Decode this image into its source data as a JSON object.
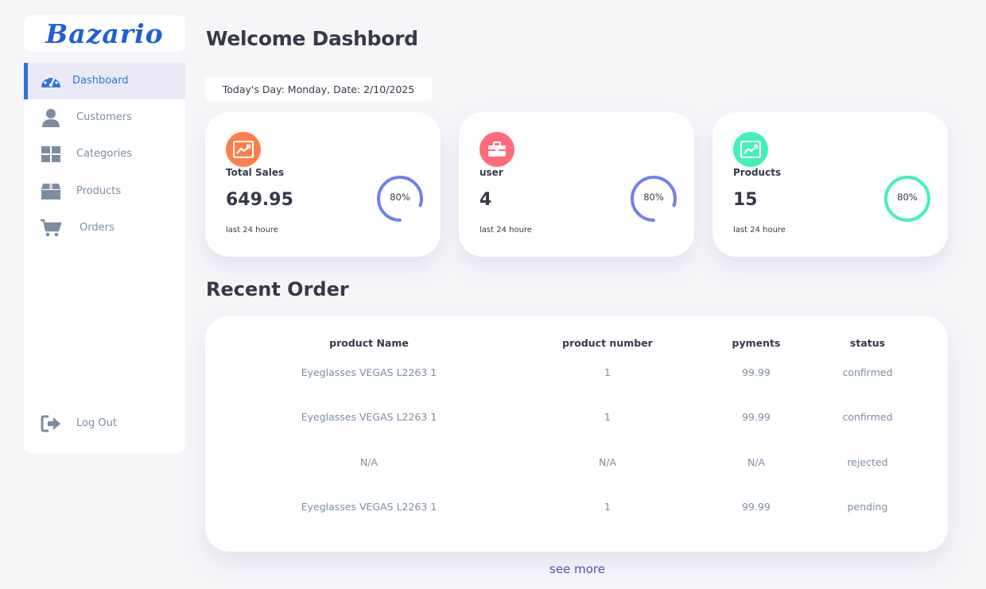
{
  "brand": {
    "logo": "Bazario",
    "color": "#1f5fd6"
  },
  "sidebar": {
    "items": [
      {
        "label": "Dashboard",
        "icon": "dashboard-gauge-icon",
        "active": true
      },
      {
        "label": "Customers",
        "icon": "user-icon",
        "active": false
      },
      {
        "label": "Categories",
        "icon": "grid-icon",
        "active": false
      },
      {
        "label": "Products",
        "icon": "box-icon",
        "active": false
      },
      {
        "label": "Orders",
        "icon": "cart-icon",
        "active": false
      }
    ],
    "logout": {
      "label": "Log Out",
      "icon": "logout-icon"
    }
  },
  "header": {
    "title": "Welcome Dashbord",
    "date_text": "Today's Day: Monday, Date: 2/10/2025"
  },
  "cards": [
    {
      "title": "Total Sales",
      "value": "649.95",
      "sub": "last 24 houre",
      "percent_label": "80%",
      "percent": 80,
      "icon": "chart-line-icon",
      "icon_color": "#ff7d4a",
      "ring_color": "#7380ec"
    },
    {
      "title": "user",
      "value": "4",
      "sub": "last 24 houre",
      "percent_label": "80%",
      "percent": 80,
      "icon": "briefcase-icon",
      "icon_color": "#ff6b7a",
      "ring_color": "#7380ec"
    },
    {
      "title": "Products",
      "value": "15",
      "sub": "last 24 houre",
      "percent_label": "80%",
      "percent": 80,
      "icon": "chart-line-icon",
      "icon_color": "#41f1b6",
      "ring_color": "#41f1b6"
    }
  ],
  "orders": {
    "title": "Recent Order",
    "columns": [
      "product Name",
      "product number",
      "pyments",
      "status"
    ],
    "rows": [
      [
        "Eyeglasses VEGAS L2263 1",
        "1",
        "99.99",
        "confirmed"
      ],
      [
        "Eyeglasses VEGAS L2263 1",
        "1",
        "99.99",
        "confirmed"
      ],
      [
        "N/A",
        "N/A",
        "N/A",
        "rejected"
      ],
      [
        "Eyeglasses VEGAS L2263 1",
        "1",
        "99.99",
        "pending"
      ]
    ],
    "see_more": "see more"
  }
}
